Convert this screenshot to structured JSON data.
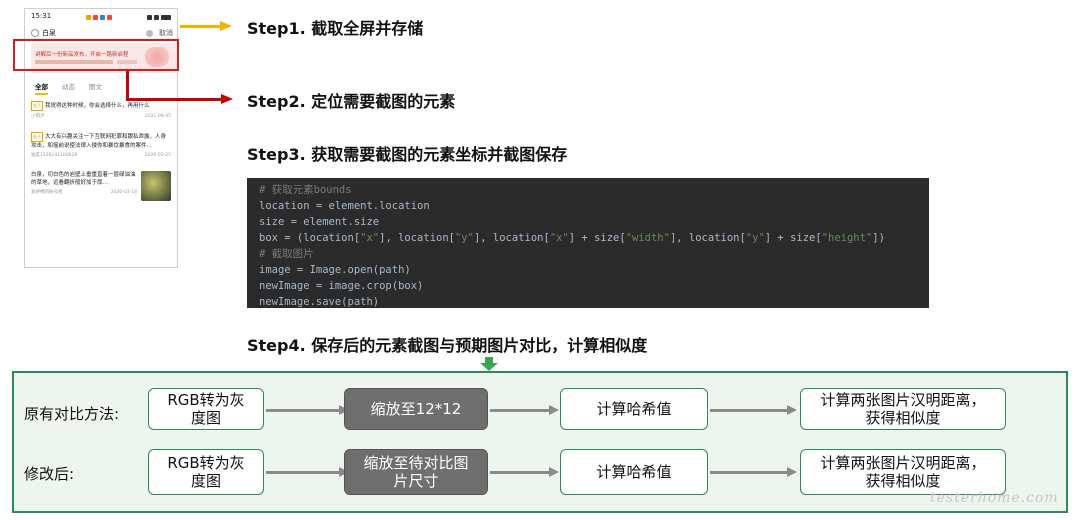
{
  "phone": {
    "time": "15:31",
    "search_text": "白泉",
    "cancel_label": "取消",
    "banner_text": "讲解后一份新品发布，开启一路新启程",
    "tabs": [
      "全部",
      "动态",
      "图文"
    ],
    "items": [
      {
        "tag": "帖子",
        "text": "我觉得这种时候，你会选择什么，再用什么",
        "author": "小萌犬",
        "date": "2021-08-05"
      },
      {
        "tag": "帖子",
        "text": "大大有兴趣关注一下互联网犯罪和跟私泄露，人身攻击，和摇前说使法律入侵你和暴饮暴食的案件…",
        "author": "福友1536141100628",
        "date": "2020-03-25"
      },
      {
        "tag": "",
        "text": "白泉，切白色的岩壁上垂重直着一层绿油油的草地，远看翻折般好加于厚…",
        "author": "爱拼搏的帐号君",
        "date": "2020-03-18"
      }
    ]
  },
  "steps": {
    "step1": "Step1. 截取全屏并存储",
    "step2": "Step2. 定位需要截图的元素",
    "step3": "Step3. 获取需要截图的元素坐标并截图保存",
    "step4": "Step4. 保存后的元素截图与预期图片对比，计算相似度"
  },
  "code": {
    "c1": "# 获取元素bounds",
    "l1": "location = element.location",
    "l2": "size = element.size",
    "l3a": "box = (location[",
    "s_x": "\"x\"",
    "l3b": "], location[",
    "s_y": "\"y\"",
    "l3c": "], location[",
    "l3d": "] + size[",
    "s_w": "\"width\"",
    "l3e": "], location[",
    "l3f": "] + size[",
    "s_h": "\"height\"",
    "l3g": "])",
    "c2": "# 截取图片",
    "l4": "image = Image.open(path)",
    "l5": "newImage = image.crop(box)",
    "l6": "newImage.save(path)"
  },
  "flow": {
    "row1": {
      "label": "原有对比方法:",
      "boxes": [
        "RGB转为灰\n度图",
        "缩放至12*12",
        "计算哈希值",
        "计算两张图片汉明距离，\n获得相似度"
      ]
    },
    "row2": {
      "label": "修改后:",
      "boxes": [
        "RGB转为灰\n度图",
        "缩放至待对比图\n片尺寸",
        "计算哈希值",
        "计算两张图片汉明距离，\n获得相似度"
      ]
    }
  },
  "colors": {
    "highlight_red": "#d0201e",
    "step1_arrow": "#f2b400",
    "panel_border": "#2e8b57",
    "code_bg": "#2b2b2b"
  },
  "watermark": "testerhome.com"
}
